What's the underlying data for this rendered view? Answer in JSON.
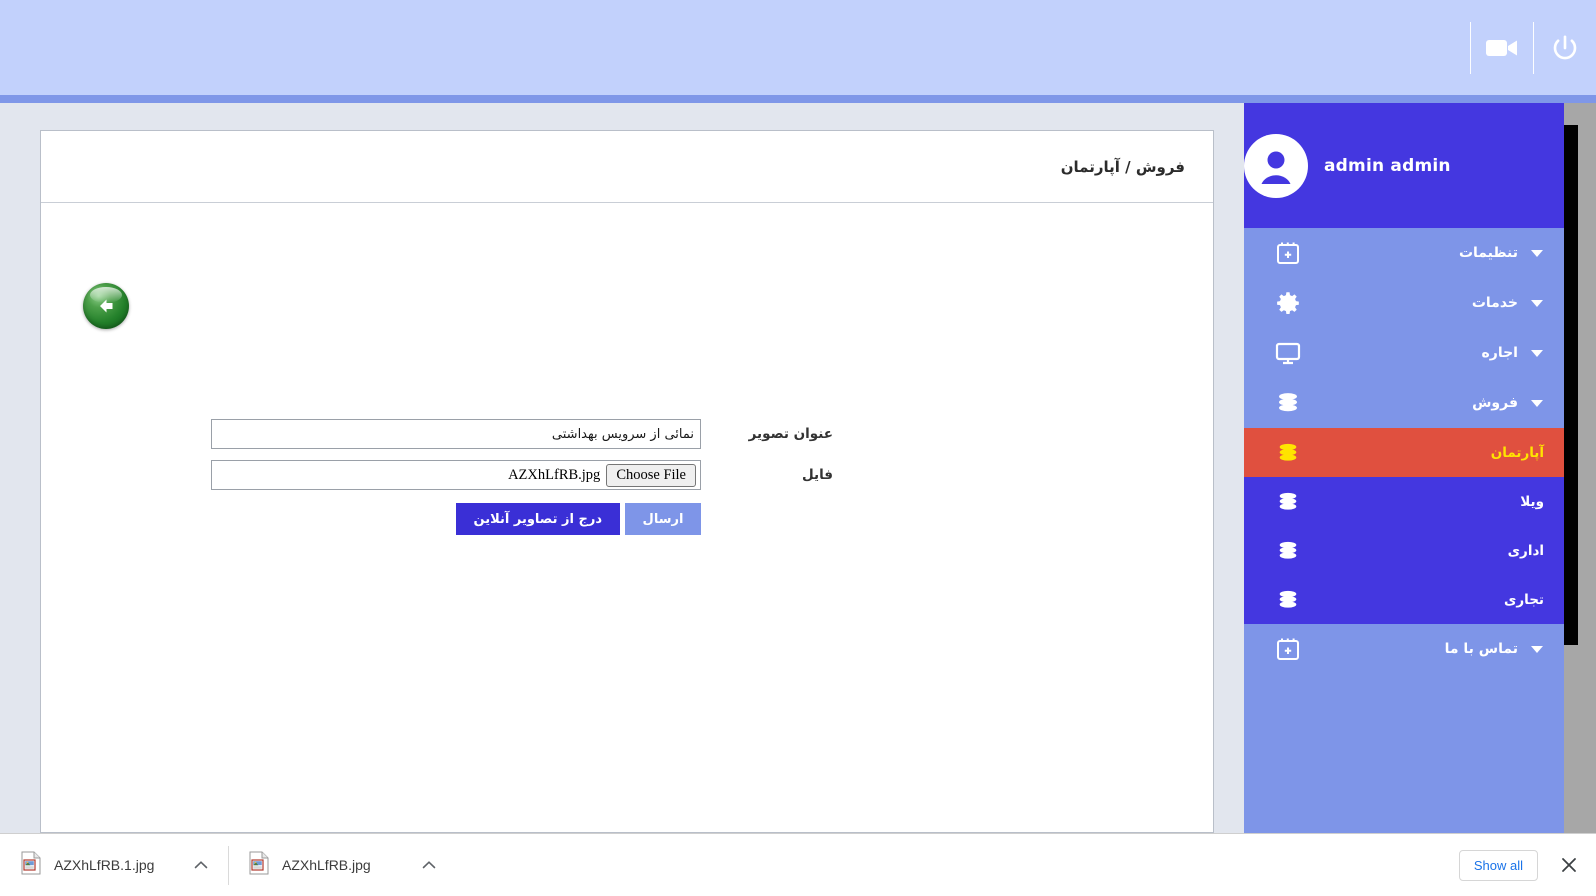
{
  "topbar": {
    "icons": [
      {
        "name": "power-icon",
        "label": "Power"
      },
      {
        "name": "video-camera-icon",
        "label": "Video"
      }
    ]
  },
  "card": {
    "breadcrumb": "فروش / آپارتمان",
    "back_button": "بازگشت",
    "form": {
      "rows": [
        {
          "label": "عنوان تصویر",
          "type": "text",
          "value": "نمائی از سرویس بهداشتی",
          "placeholder": ""
        },
        {
          "label": "فایل",
          "type": "file",
          "button": "Choose File",
          "filename": "AZXhLfRB.jpg"
        }
      ],
      "buttons": {
        "submit": "ارسال",
        "online_images": "درج از تصاویر آنلاین"
      }
    }
  },
  "sidebar": {
    "user": {
      "name": "admin admin"
    },
    "menu": [
      {
        "label": "تنظیمات",
        "icon": "calendar-plus-icon",
        "caret": true
      },
      {
        "label": "خدمات",
        "icon": "gear-icon",
        "caret": true
      },
      {
        "label": "اجاره",
        "icon": "monitor-icon",
        "caret": true
      },
      {
        "label": "فروش",
        "icon": "database-icon",
        "caret": true
      }
    ],
    "submenu": [
      {
        "label": "آپارتمان",
        "icon": "database-icon",
        "active": true
      },
      {
        "label": "ویلا",
        "icon": "database-icon",
        "active": false
      },
      {
        "label": "اداری",
        "icon": "database-icon",
        "active": false
      },
      {
        "label": "تجاری",
        "icon": "database-icon",
        "active": false
      }
    ],
    "footer_menu": [
      {
        "label": "تماس با ما",
        "icon": "calendar-plus-icon",
        "caret": true
      }
    ]
  },
  "download_shelf": {
    "items": [
      {
        "name": "AZXhLfRB.1.jpg",
        "icon": "image-file-icon",
        "chevron": "chevron-up-icon"
      },
      {
        "name": "AZXhLfRB.jpg",
        "icon": "image-file-icon",
        "chevron": "chevron-up-icon"
      }
    ],
    "show_all": "Show all",
    "close": "×"
  },
  "colors": {
    "topbar": "#c2d1fc",
    "topbar_strip": "#7f97e8",
    "page_bg": "#e2e6ee",
    "sidebar": "#7e95e8",
    "sidebar_dark": "#4437e0",
    "active_item": "#e0503f",
    "active_text": "#ffe400",
    "btn_primary": "#3a2fd6",
    "btn_secondary": "#7e95e8",
    "link": "#1a73e8"
  }
}
